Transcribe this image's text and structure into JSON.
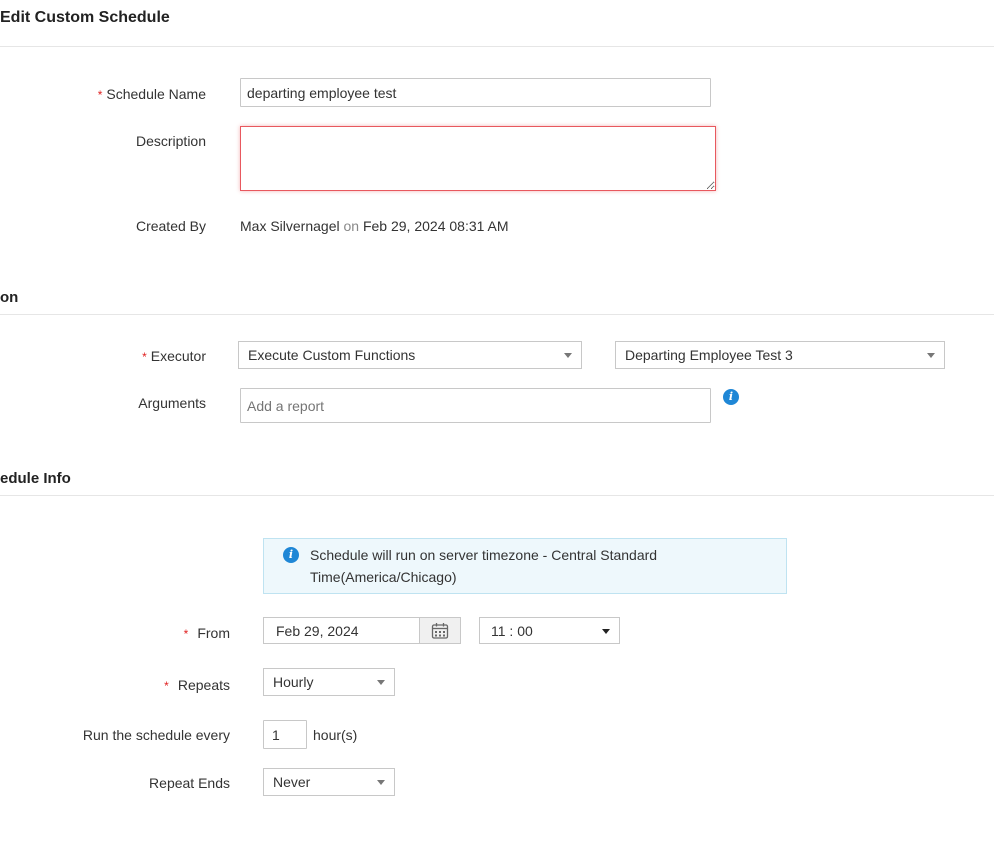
{
  "header": {
    "title": "Edit Custom Schedule"
  },
  "general": {
    "schedule_name_label": "Schedule Name",
    "schedule_name_value": "departing employee test",
    "description_label": "Description",
    "description_value": "",
    "created_by_label": "Created By",
    "created_by_user": "Max Silvernagel",
    "created_by_on": "on",
    "created_by_date": "Feb 29, 2024 08:31 AM"
  },
  "action_section": {
    "title": "on",
    "executor_label": "Executor",
    "executor_value": "Execute Custom Functions",
    "function_value": "Departing Employee Test 3",
    "arguments_label": "Arguments",
    "arguments_placeholder": "Add a report",
    "info_icon": "info-icon"
  },
  "schedule_info": {
    "title": "edule Info",
    "notice_line1": "Schedule will run on server timezone - Central Standard",
    "notice_line2": "Time(America/Chicago)",
    "from_label": "From",
    "from_date": "Feb 29, 2024",
    "from_time": "11 : 00",
    "repeats_label": "Repeats",
    "repeats_value": "Hourly",
    "run_every_label": "Run the schedule every",
    "run_every_value": "1",
    "run_every_unit": "hour(s)",
    "repeat_ends_label": "Repeat Ends",
    "repeat_ends_value": "Never"
  },
  "colors": {
    "required": "#e02020",
    "info": "#1f87d6",
    "notice_bg": "#eef8fc",
    "error_border": "#e8585e"
  }
}
